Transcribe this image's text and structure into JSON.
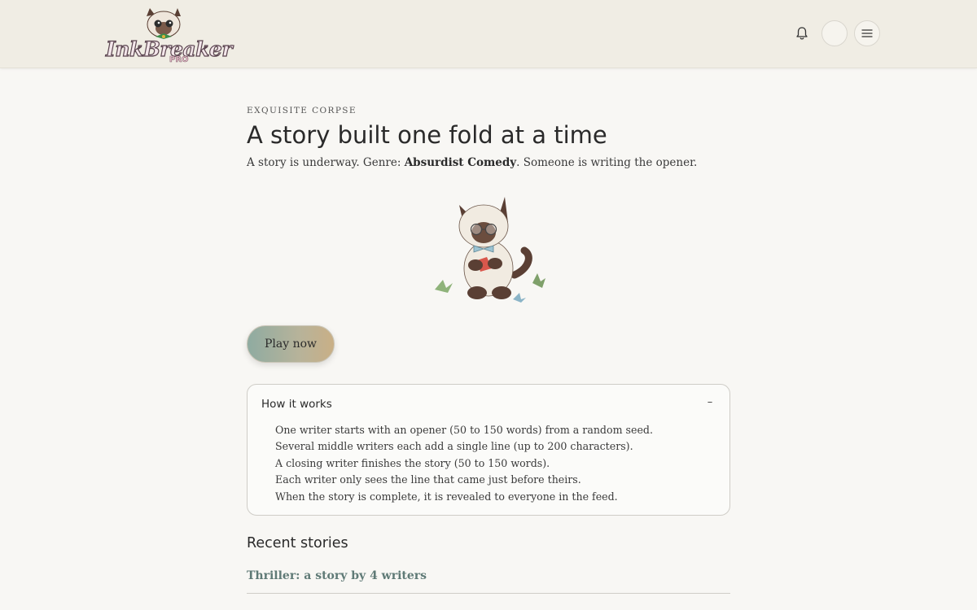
{
  "header": {
    "logo_text": "InkBreaker",
    "logo_badge": "PRO",
    "notifications_icon": "bell-icon",
    "avatar_icon": "avatar",
    "menu_icon": "hamburger-menu-icon"
  },
  "main": {
    "eyebrow": "EXQUISITE CORPSE",
    "title": "A story built one fold at a time",
    "subtitle_prefix": "A story is underway. Genre: ",
    "genre": "Absurdist Comedy",
    "subtitle_suffix": ". Someone is writing the opener.",
    "illustration": "siamese-cat-origami-illustration",
    "play_button": "Play now"
  },
  "how_it_works": {
    "title": "How it works",
    "toggle": "–",
    "steps": [
      "One writer starts with an opener (50 to 150 words) from a random seed.",
      "Several middle writers each add a single line (up to 200 characters).",
      "A closing writer finishes the story (50 to 150 words).",
      "Each writer only sees the line that came just before theirs.",
      "When the story is complete, it is revealed to everyone in the feed."
    ]
  },
  "recent": {
    "title": "Recent stories",
    "stories": [
      {
        "label": "Thriller: a story by 4 writers"
      }
    ]
  },
  "colors": {
    "background": "#f8f7f4",
    "header_bg": "#f0ede4",
    "link": "#5f7a76",
    "button_gradient_start": "#8faba1",
    "button_gradient_end": "#c9af86"
  }
}
